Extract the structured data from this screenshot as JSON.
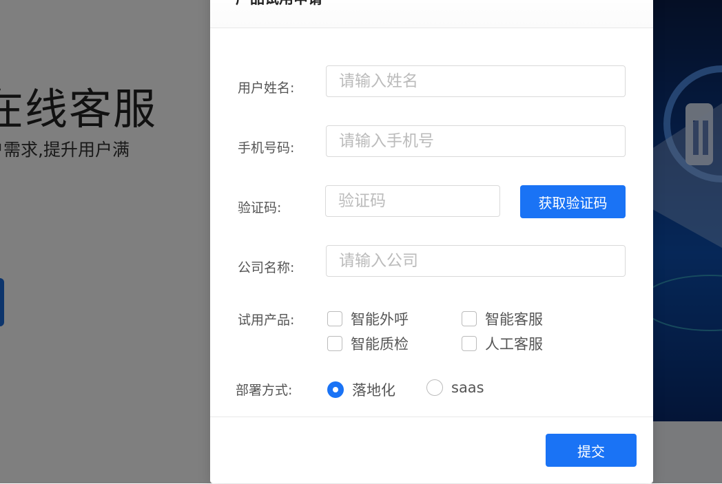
{
  "background": {
    "title": "在线客服",
    "subtitle": "户需求,提升用户满",
    "accent_color": "#1a6ad8"
  },
  "dialog": {
    "title": "产品试用申请",
    "close_icon": "close-icon",
    "fields": {
      "name": {
        "label": "用户姓名:",
        "placeholder": "请输入姓名"
      },
      "phone": {
        "label": "手机号码:",
        "placeholder": "请输入手机号"
      },
      "code": {
        "label": "验证码:",
        "placeholder": "验证码",
        "button": "获取验证码"
      },
      "company": {
        "label": "公司名称:",
        "placeholder": "请输入公司"
      }
    },
    "products": {
      "label": "试用产品:",
      "options": [
        {
          "label": "智能外呼",
          "checked": false
        },
        {
          "label": "智能客服",
          "checked": false
        },
        {
          "label": "智能质检",
          "checked": false
        },
        {
          "label": "人工客服",
          "checked": false
        }
      ]
    },
    "deploy": {
      "label": "部署方式:",
      "options": [
        {
          "label": "落地化",
          "selected": true
        },
        {
          "label": "saas",
          "selected": false
        }
      ]
    },
    "submit_label": "提交",
    "primary_color": "#1a73f5"
  }
}
